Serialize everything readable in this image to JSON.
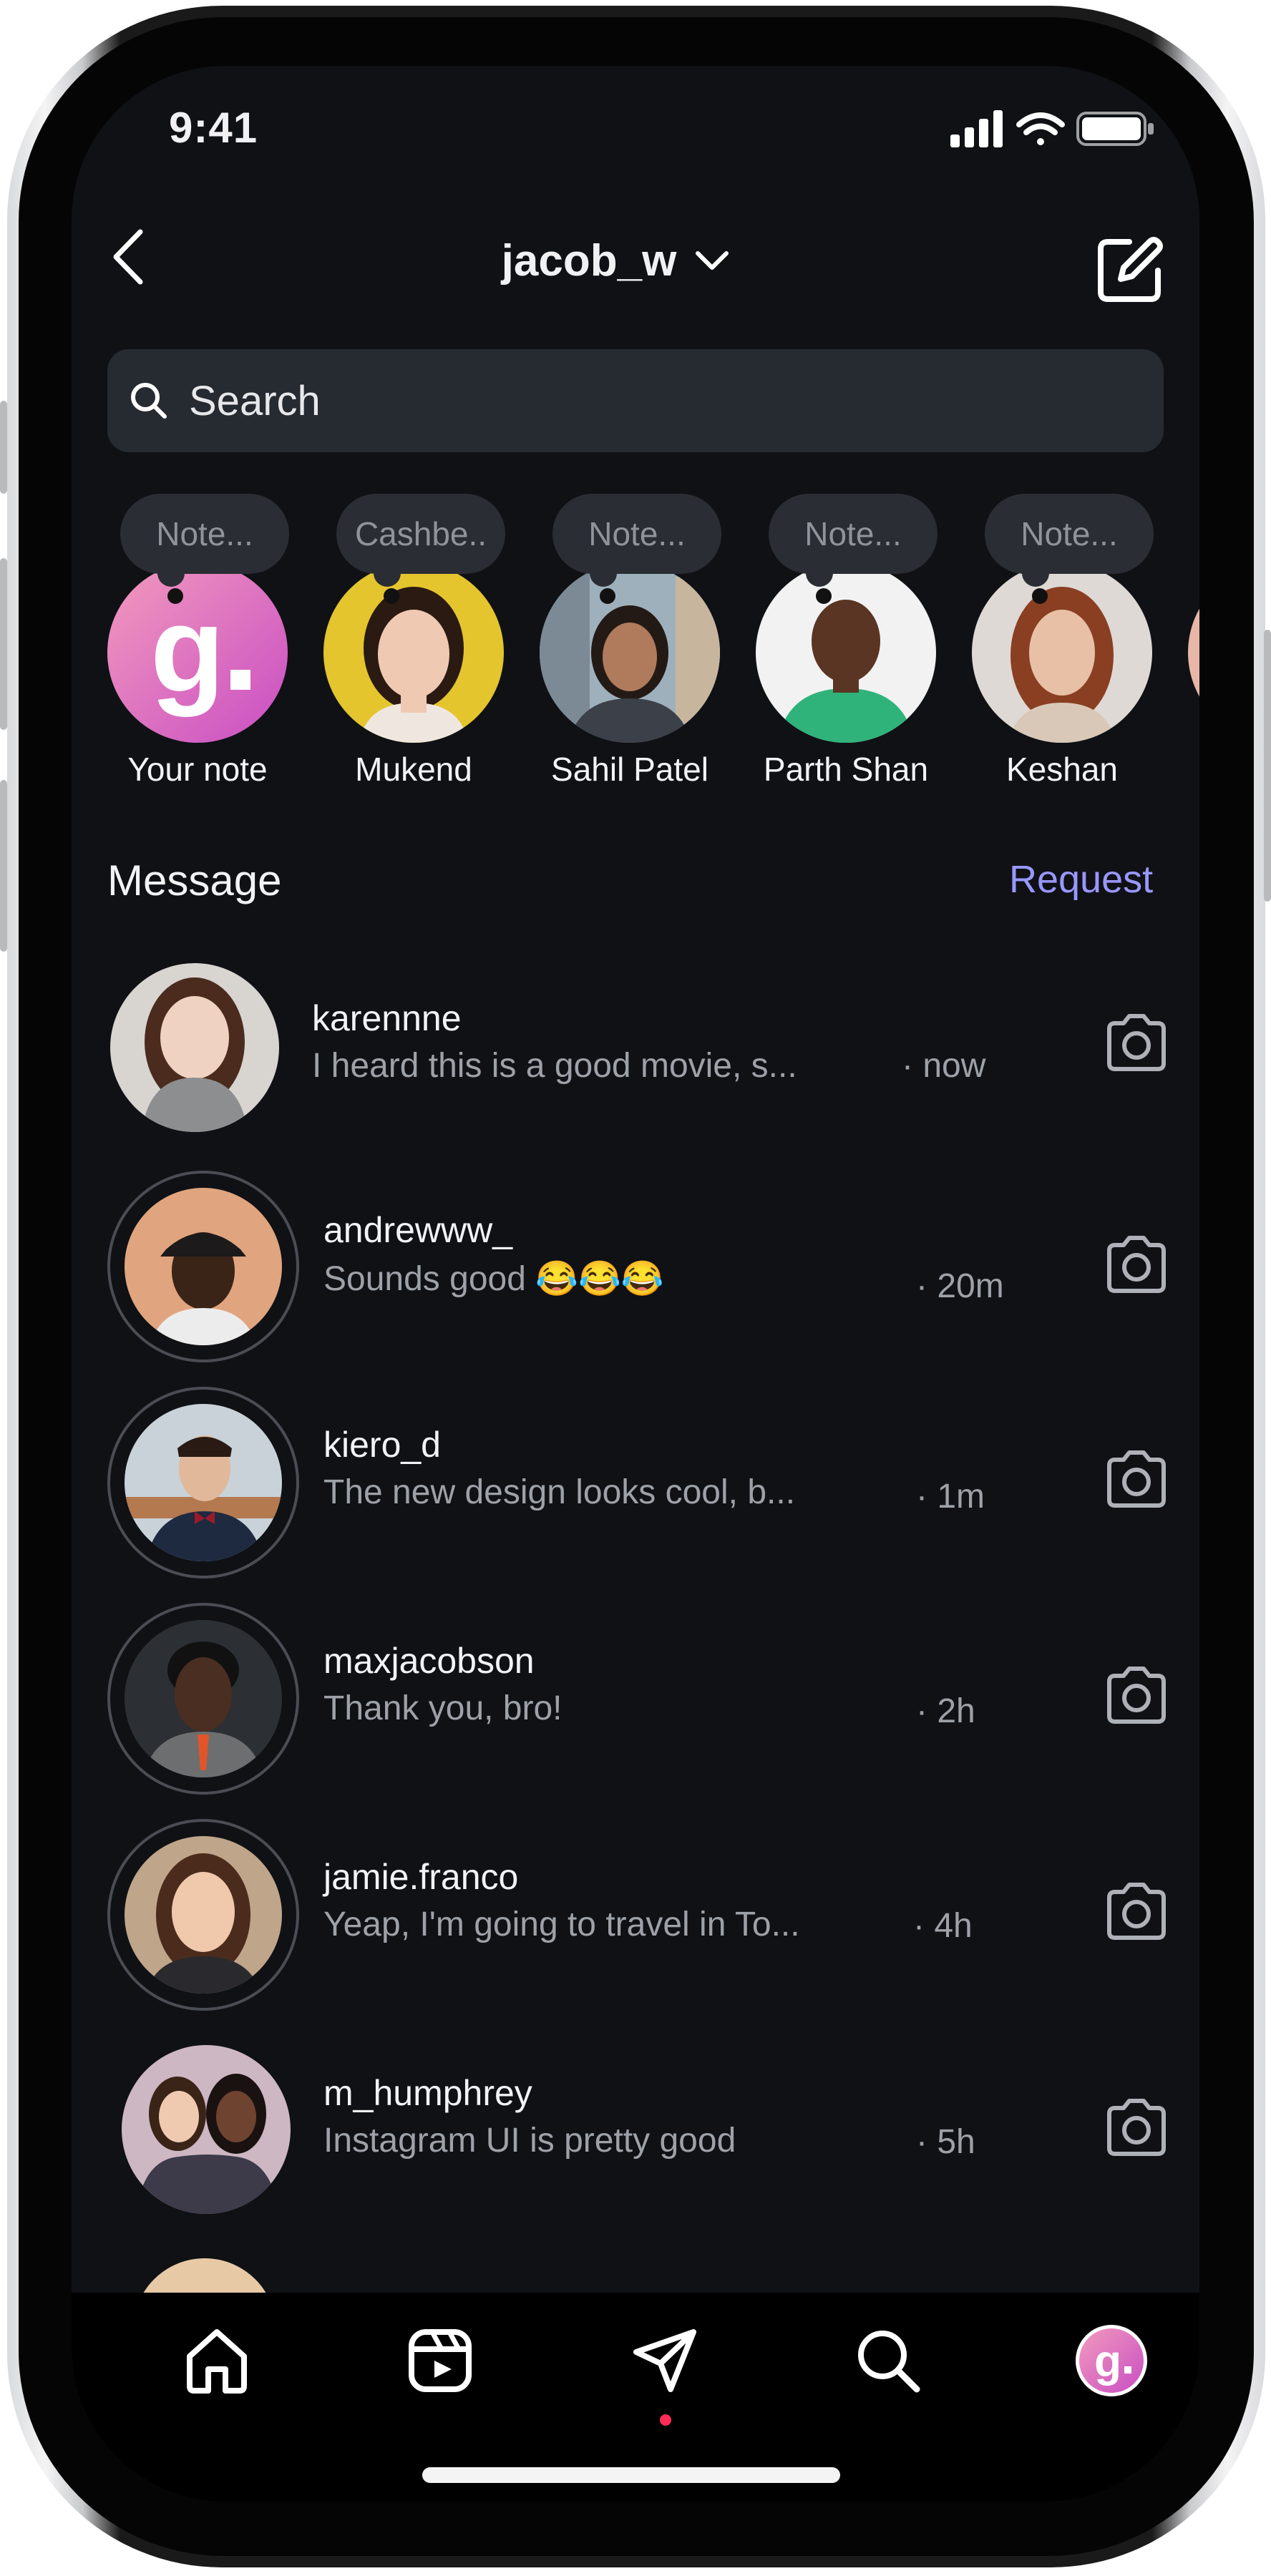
{
  "status_bar": {
    "time": "9:41"
  },
  "header": {
    "username": "jacob_w"
  },
  "search": {
    "placeholder": "Search"
  },
  "notes": [
    {
      "name": "Your note",
      "bubble": "Note...",
      "avatar": "logo-avatar"
    },
    {
      "name": "Mukend",
      "bubble": "Cashbe..",
      "avatar": "woman-yellow-bg"
    },
    {
      "name": "Sahil Patel",
      "bubble": "Note...",
      "avatar": "woman-street"
    },
    {
      "name": "Parth Shan",
      "bubble": "Note...",
      "avatar": "man-green-shirt"
    },
    {
      "name": "Keshan",
      "bubble": "Note...",
      "avatar": "woman-red-hair"
    }
  ],
  "section": {
    "title": "Message",
    "request_label": "Request"
  },
  "messages": [
    {
      "username": "karennne",
      "preview": "I heard this is a good movie, s...",
      "time": "· now"
    },
    {
      "username": "andrewww_",
      "preview": "Sounds good 😂😂😂",
      "time": "· 20m"
    },
    {
      "username": "kiero_d",
      "preview": "The new design looks cool, b...",
      "time": "· 1m"
    },
    {
      "username": "maxjacobson",
      "preview": "Thank you, bro!",
      "time": "· 2h"
    },
    {
      "username": "jamie.franco",
      "preview": "Yeap, I'm going to travel in To...",
      "time": "· 4h"
    },
    {
      "username": "m_humphrey",
      "preview": "Instagram UI is pretty good",
      "time": "· 5h"
    }
  ],
  "tab_bar": {
    "tabs": [
      "home-icon",
      "reels-icon",
      "direct-message-icon",
      "search-icon",
      "profile-avatar"
    ],
    "active": "direct-message-icon"
  },
  "colors": {
    "background": "#0f1115",
    "search_bg": "#262a31",
    "request_link": "#9a97ff",
    "active_dot": "#ff2d55"
  }
}
